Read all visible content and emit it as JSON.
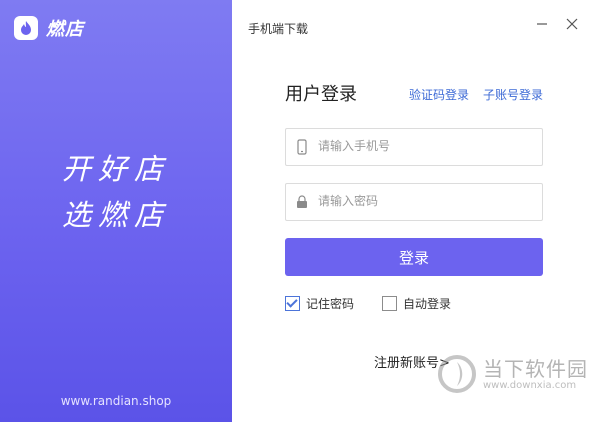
{
  "brand": {
    "logo_text": "燃店",
    "slogan_line1": "开好店",
    "slogan_line2": "选燃店",
    "website": "www.randian.shop",
    "accent": "#6c63ef"
  },
  "top": {
    "mobile_download": "手机端下载",
    "minimize_icon": "minimize-icon",
    "close_icon": "close-icon"
  },
  "login": {
    "title": "用户登录",
    "sms_login": "验证码登录",
    "sub_account_login": "子账号登录",
    "phone_placeholder": "请输入手机号",
    "password_placeholder": "请输入密码",
    "submit": "登录",
    "remember_password": "记住密码",
    "remember_checked": true,
    "auto_login": "自动登录",
    "auto_checked": false,
    "register": "注册新账号>"
  },
  "watermark": {
    "name": "当下软件园",
    "url": "www.downxia.com"
  }
}
